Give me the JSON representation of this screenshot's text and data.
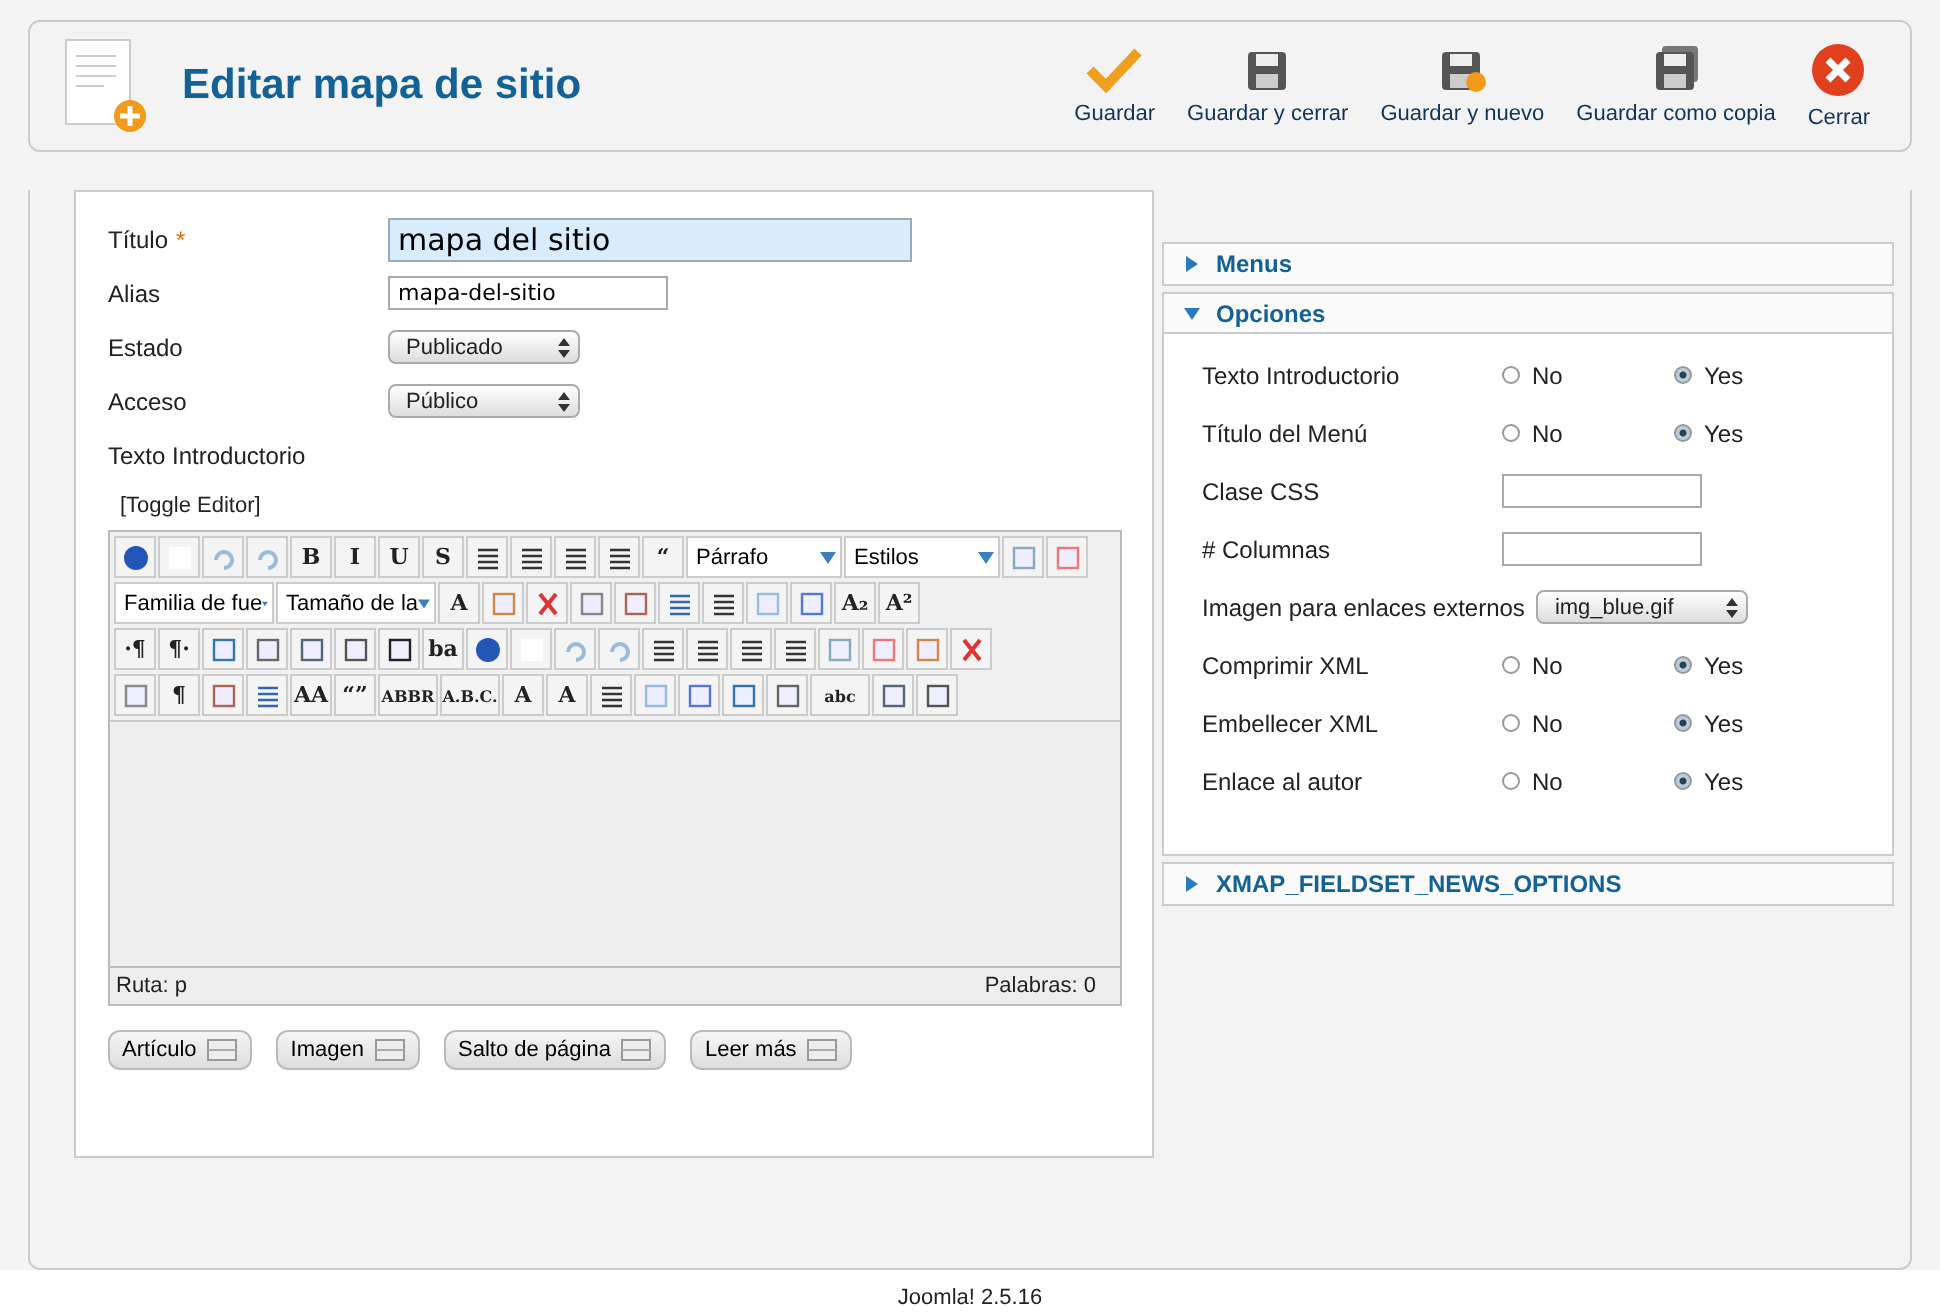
{
  "header": {
    "title": "Editar mapa de sitio",
    "actions": [
      {
        "kind": "check",
        "label": "Guardar"
      },
      {
        "kind": "disk",
        "label": "Guardar y cerrar"
      },
      {
        "kind": "disk-plus",
        "label": "Guardar y nuevo"
      },
      {
        "kind": "disk-copy",
        "label": "Guardar como copia"
      },
      {
        "kind": "close",
        "label": "Cerrar"
      }
    ]
  },
  "form": {
    "fields": [
      {
        "kind": "title",
        "label": "Título",
        "required": "*",
        "value": "mapa del sitio"
      },
      {
        "kind": "text",
        "label": "Alias",
        "value": "mapa-del-sitio"
      },
      {
        "kind": "select",
        "label": "Estado",
        "value": "Publicado"
      },
      {
        "kind": "select",
        "label": "Acceso",
        "value": "Público"
      },
      {
        "kind": "label",
        "label": "Texto Introductorio"
      }
    ],
    "toggle": "[Toggle Editor]",
    "editor": {
      "toolbar_rows": [
        [
          {
            "kind": "icon"
          },
          {
            "kind": "icon"
          },
          {
            "kind": "icon"
          },
          {
            "kind": "icon"
          },
          {
            "kind": "glyph",
            "text": "B"
          },
          {
            "kind": "glyph",
            "text": "I"
          },
          {
            "kind": "glyph",
            "text": "U"
          },
          {
            "kind": "glyph",
            "text": "S"
          },
          {
            "kind": "icon"
          },
          {
            "kind": "icon"
          },
          {
            "kind": "icon"
          },
          {
            "kind": "icon"
          },
          {
            "kind": "glyph",
            "text": "“"
          },
          {
            "kind": "select",
            "value": "Párrafo"
          },
          {
            "kind": "select",
            "value": "Estilos"
          },
          {
            "kind": "icon"
          },
          {
            "kind": "icon"
          }
        ],
        [
          {
            "kind": "select",
            "value": "Familia de fue"
          },
          {
            "kind": "select",
            "value": "Tamaño de la"
          },
          {
            "kind": "glyph",
            "text": "A"
          },
          {
            "kind": "icon"
          },
          {
            "kind": "icon"
          },
          {
            "kind": "icon"
          },
          {
            "kind": "icon"
          },
          {
            "kind": "icon"
          },
          {
            "kind": "icon"
          },
          {
            "kind": "icon"
          },
          {
            "kind": "icon"
          },
          {
            "kind": "glyph",
            "text": "A₂"
          },
          {
            "kind": "glyph",
            "text": "A²"
          }
        ],
        [
          {
            "kind": "glyph",
            "text": "·¶"
          },
          {
            "kind": "glyph",
            "text": "¶·"
          },
          {
            "kind": "icon"
          },
          {
            "kind": "icon"
          },
          {
            "kind": "icon"
          },
          {
            "kind": "icon"
          },
          {
            "kind": "icon"
          },
          {
            "kind": "glyph",
            "text": "ba"
          },
          {
            "kind": "icon"
          },
          {
            "kind": "icon"
          },
          {
            "kind": "icon"
          },
          {
            "kind": "icon"
          },
          {
            "kind": "icon"
          },
          {
            "kind": "icon"
          },
          {
            "kind": "icon"
          },
          {
            "kind": "icon"
          },
          {
            "kind": "icon"
          },
          {
            "kind": "icon"
          },
          {
            "kind": "icon"
          },
          {
            "kind": "icon"
          }
        ],
        [
          {
            "kind": "icon"
          },
          {
            "kind": "glyph",
            "text": "¶"
          },
          {
            "kind": "icon"
          },
          {
            "kind": "icon"
          },
          {
            "kind": "glyph",
            "text": "AA"
          },
          {
            "kind": "glyph",
            "text": "“”"
          },
          {
            "kind": "glyph",
            "text": "ABBR"
          },
          {
            "kind": "glyph",
            "text": "A.B.C."
          },
          {
            "kind": "glyph",
            "text": "A"
          },
          {
            "kind": "glyph",
            "text": "A"
          },
          {
            "kind": "icon"
          },
          {
            "kind": "icon"
          },
          {
            "kind": "icon"
          },
          {
            "kind": "icon"
          },
          {
            "kind": "icon"
          },
          {
            "kind": "glyph",
            "text": "abc"
          },
          {
            "kind": "icon"
          },
          {
            "kind": "icon"
          }
        ]
      ],
      "path_label": "Ruta:  p",
      "words": "Palabras: 0"
    },
    "buttons": [
      "Artículo",
      "Imagen",
      "Salto de página",
      "Leer más"
    ]
  },
  "panel": {
    "sections": [
      {
        "title": "Menus",
        "expanded": false
      },
      {
        "title": "Opciones",
        "expanded": true,
        "rows": [
          {
            "kind": "radio",
            "label": "Texto Introductorio",
            "options": [
              {
                "label": "No",
                "selected": false
              },
              {
                "label": "Yes",
                "selected": true
              }
            ]
          },
          {
            "kind": "radio",
            "label": "Título del Menú",
            "options": [
              {
                "label": "No",
                "selected": false
              },
              {
                "label": "Yes",
                "selected": true
              }
            ]
          },
          {
            "kind": "text",
            "label": "Clase CSS"
          },
          {
            "kind": "text",
            "label": "# Columnas"
          },
          {
            "kind": "select",
            "label": "Imagen para enlaces externos",
            "value": "img_blue.gif"
          },
          {
            "kind": "radio",
            "label": "Comprimir XML",
            "options": [
              {
                "label": "No",
                "selected": false
              },
              {
                "label": "Yes",
                "selected": true
              }
            ]
          },
          {
            "kind": "radio",
            "label": "Embellecer XML",
            "options": [
              {
                "label": "No",
                "selected": false
              },
              {
                "label": "Yes",
                "selected": true
              }
            ]
          },
          {
            "kind": "radio",
            "label": "Enlace al autor",
            "options": [
              {
                "label": "No",
                "selected": false
              },
              {
                "label": "Yes",
                "selected": true
              }
            ]
          }
        ]
      },
      {
        "title": "XMAP_FIELDSET_NEWS_OPTIONS",
        "expanded": false
      }
    ]
  },
  "footer": "Joomla! 2.5.16"
}
